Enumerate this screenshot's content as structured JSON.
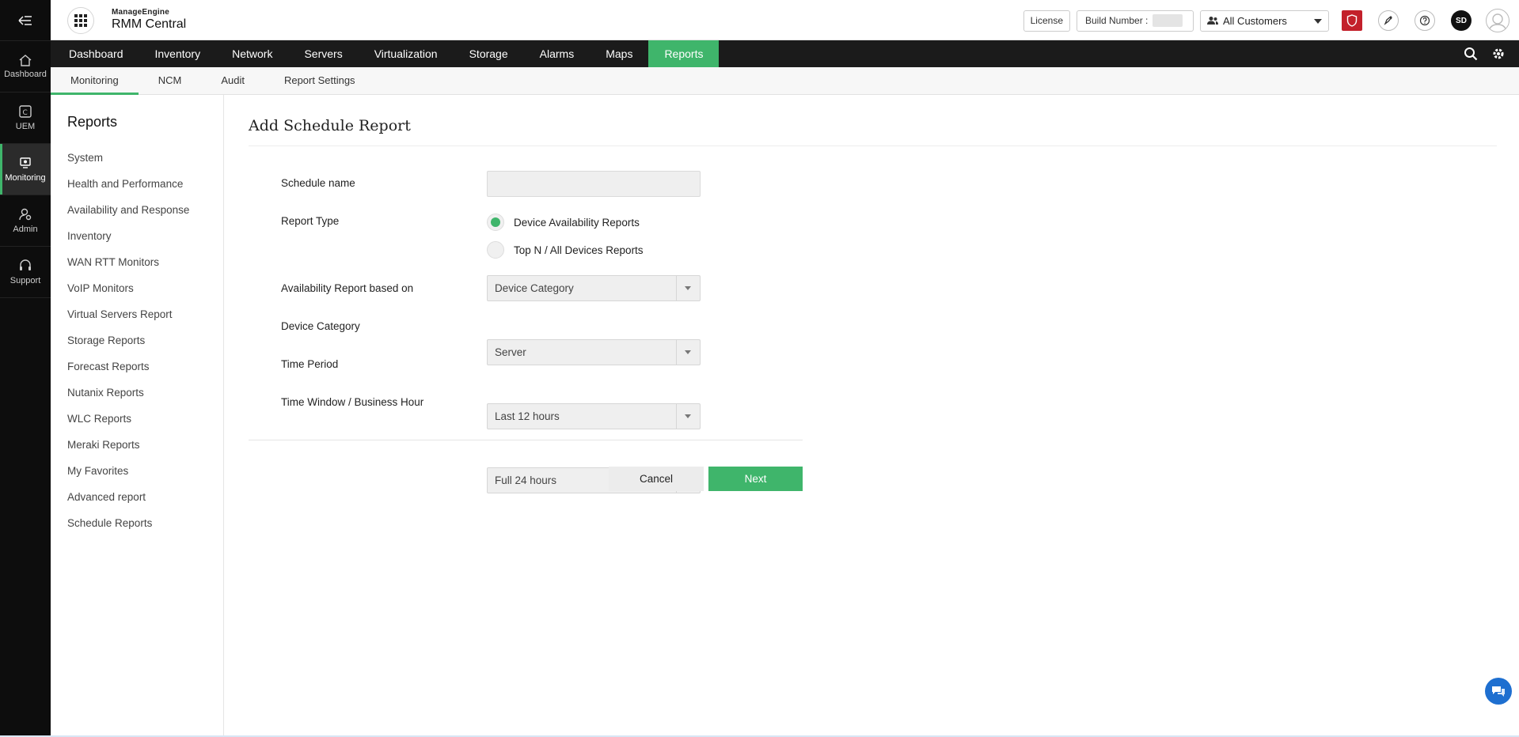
{
  "rail": {
    "items": [
      {
        "label": "Dashboard",
        "icon": "home-icon"
      },
      {
        "label": "UEM",
        "icon": "uem-icon"
      },
      {
        "label": "Monitoring",
        "icon": "monitoring-icon",
        "active": true
      },
      {
        "label": "Admin",
        "icon": "admin-icon"
      },
      {
        "label": "Support",
        "icon": "headset-icon"
      }
    ]
  },
  "header": {
    "brand_top": "ManageEngine",
    "brand_name": "RMM Central",
    "license_label": "License",
    "build_label": "Build Number :",
    "customer_value": "All Customers",
    "user_initials": "SD"
  },
  "mainnav": {
    "tabs": [
      "Dashboard",
      "Inventory",
      "Network",
      "Servers",
      "Virtualization",
      "Storage",
      "Alarms",
      "Maps",
      "Reports"
    ],
    "active": "Reports"
  },
  "subnav": {
    "tabs": [
      "Monitoring",
      "NCM",
      "Audit",
      "Report Settings"
    ],
    "active": "Monitoring"
  },
  "sidebar": {
    "title": "Reports",
    "items": [
      "System",
      "Health and Performance",
      "Availability and Response",
      "Inventory",
      "WAN RTT Monitors",
      "VoIP Monitors",
      "Virtual Servers Report",
      "Storage Reports",
      "Forecast Reports",
      "Nutanix Reports",
      "WLC Reports",
      "Meraki Reports",
      "My Favorites",
      "Advanced report",
      "Schedule Reports"
    ]
  },
  "form": {
    "title": "Add Schedule Report",
    "schedule_name_label": "Schedule name",
    "schedule_name_value": "",
    "report_type_label": "Report Type",
    "report_type_options": [
      "Device Availability Reports",
      "Top N / All Devices Reports"
    ],
    "report_type_selected": "Device Availability Reports",
    "availability_based_label": "Availability Report based on",
    "availability_based_value": "Device Category",
    "device_category_label": "Device Category",
    "device_category_value": "Server",
    "time_period_label": "Time Period",
    "time_period_value": "Last 12 hours",
    "time_window_label": "Time Window / Business Hour",
    "time_window_value": "Full 24 hours",
    "cancel_label": "Cancel",
    "next_label": "Next"
  },
  "colors": {
    "accent": "#3fb56b",
    "rail_bg": "#0d0d0d",
    "nav_bg": "#1b1b1b",
    "shield": "#c3202b",
    "chat": "#1e6fd0"
  }
}
